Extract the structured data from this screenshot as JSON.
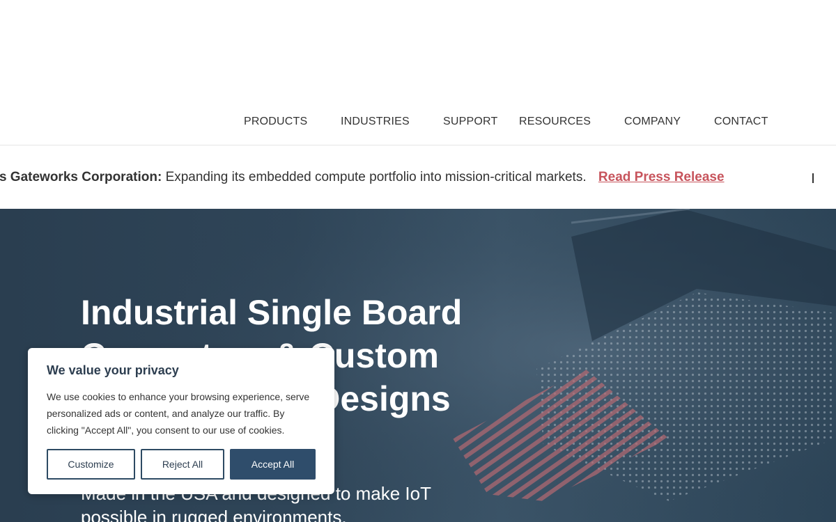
{
  "nav": {
    "items": [
      "PRODUCTS",
      "INDUSTRIES",
      "SUPPORT",
      "RESOURCES",
      "COMPANY",
      "CONTACT"
    ]
  },
  "ticker": {
    "bold": "res Gateworks Corporation:",
    "text": "Expanding its embedded compute portfolio into mission-critical markets.",
    "link": "Read Press Release"
  },
  "hero": {
    "title": "Industrial Single Board Computers & Custom Carrier Board Designs",
    "subtitle": "Made in the USA and designed to make IoT possible in rugged environments."
  },
  "cookie": {
    "title": "We value your privacy",
    "text": "We use cookies to enhance your browsing experience, serve personalized ads or content, and analyze our traffic. By clicking \"Accept All\", you consent to our use of cookies.",
    "customize": "Customize",
    "reject": "Reject All",
    "accept": "Accept All"
  },
  "colors": {
    "accent": "#2f4d6b",
    "link": "#c7545c",
    "hero_bg": "#2f4558"
  }
}
